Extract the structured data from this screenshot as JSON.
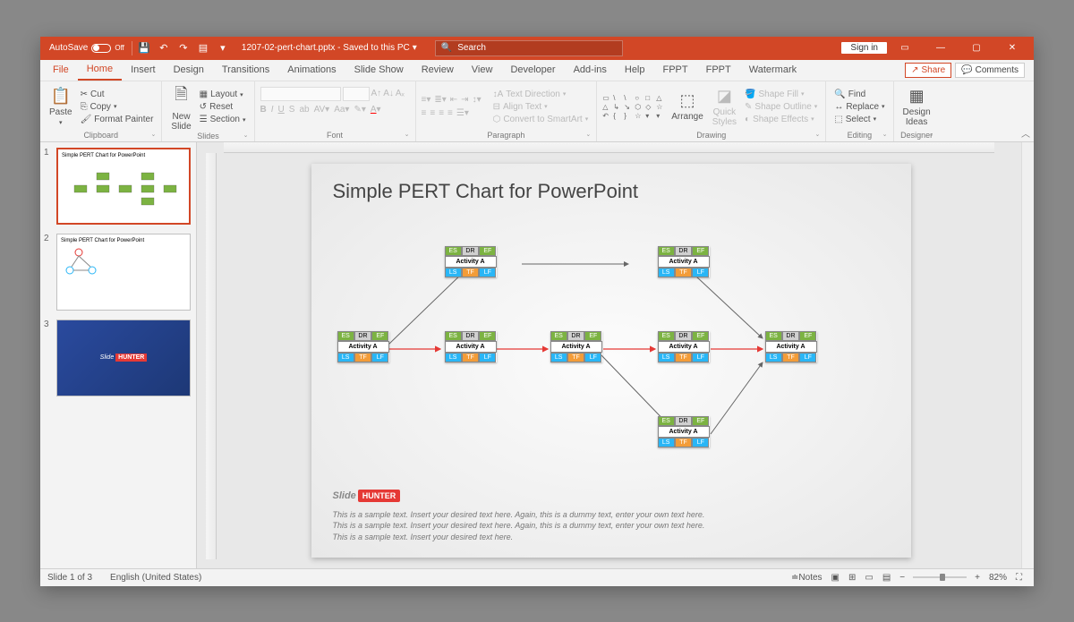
{
  "titlebar": {
    "autosave_label": "AutoSave",
    "autosave_state": "Off",
    "document_title": "1207-02-pert-chart.pptx - Saved to this PC",
    "search_placeholder": "Search",
    "signin": "Sign in"
  },
  "tabs": {
    "file": "File",
    "home": "Home",
    "insert": "Insert",
    "design": "Design",
    "transitions": "Transitions",
    "animations": "Animations",
    "slideshow": "Slide Show",
    "review": "Review",
    "view": "View",
    "developer": "Developer",
    "addins": "Add-ins",
    "help": "Help",
    "fppt1": "FPPT",
    "fppt2": "FPPT",
    "watermark": "Watermark",
    "share": "Share",
    "comments": "Comments"
  },
  "ribbon": {
    "clipboard": {
      "label": "Clipboard",
      "paste": "Paste",
      "cut": "Cut",
      "copy": "Copy",
      "format_painter": "Format Painter"
    },
    "slides": {
      "label": "Slides",
      "new_slide": "New\nSlide",
      "layout": "Layout",
      "reset": "Reset",
      "section": "Section"
    },
    "font": {
      "label": "Font"
    },
    "paragraph": {
      "label": "Paragraph",
      "text_direction": "Text Direction",
      "align_text": "Align Text",
      "convert_smartart": "Convert to SmartArt"
    },
    "drawing": {
      "label": "Drawing",
      "arrange": "Arrange",
      "quick_styles": "Quick\nStyles",
      "shape_fill": "Shape Fill",
      "shape_outline": "Shape Outline",
      "shape_effects": "Shape Effects"
    },
    "editing": {
      "label": "Editing",
      "find": "Find",
      "replace": "Replace",
      "select": "Select"
    },
    "designer": {
      "label": "Designer",
      "design_ideas": "Design\nIdeas"
    }
  },
  "thumbnails": {
    "t1": "Simple PERT Chart for PowerPoint",
    "t2": "Simple PERT Chart for PowerPoint"
  },
  "slide": {
    "title": "Simple PERT Chart for PowerPoint",
    "node_labels": {
      "es": "ES",
      "dr": "DR",
      "ef": "EF",
      "activity": "Activity A",
      "ls": "LS",
      "tf": "TF",
      "lf": "LF"
    },
    "logo_a": "Slide",
    "logo_b": "HUNTER",
    "sample1": "This is a sample text. Insert your desired text here. Again, this is a dummy text, enter your own text here.",
    "sample2": "This is a sample text. Insert your desired text here. Again, this is a dummy text, enter your own text here.",
    "sample3": "This is a sample text. Insert your desired text here."
  },
  "statusbar": {
    "slide_count": "Slide 1 of 3",
    "language": "English (United States)",
    "notes": "Notes",
    "zoom": "82%"
  },
  "chart_data": {
    "type": "diagram",
    "title": "Simple PERT Chart",
    "nodes": [
      {
        "id": "n1",
        "row": "mid",
        "col": 0,
        "label": "Activity A"
      },
      {
        "id": "n2",
        "row": "mid",
        "col": 1,
        "label": "Activity A"
      },
      {
        "id": "n3",
        "row": "top",
        "col": 1,
        "label": "Activity A"
      },
      {
        "id": "n4",
        "row": "mid",
        "col": 2,
        "label": "Activity A"
      },
      {
        "id": "n5",
        "row": "top",
        "col": 3,
        "label": "Activity A"
      },
      {
        "id": "n6",
        "row": "mid",
        "col": 3,
        "label": "Activity A"
      },
      {
        "id": "n7",
        "row": "bot",
        "col": 3,
        "label": "Activity A"
      },
      {
        "id": "n8",
        "row": "mid",
        "col": 4,
        "label": "Activity A"
      }
    ],
    "edges": [
      {
        "from": "n1",
        "to": "n2",
        "critical": true
      },
      {
        "from": "n1",
        "to": "n3",
        "critical": false
      },
      {
        "from": "n2",
        "to": "n4",
        "critical": true
      },
      {
        "from": "n3",
        "to": "n5",
        "critical": false
      },
      {
        "from": "n4",
        "to": "n6",
        "critical": true
      },
      {
        "from": "n4",
        "to": "n7",
        "critical": false
      },
      {
        "from": "n6",
        "to": "n8",
        "critical": true
      },
      {
        "from": "n5",
        "to": "n8",
        "critical": false
      },
      {
        "from": "n7",
        "to": "n8",
        "critical": false
      }
    ]
  }
}
